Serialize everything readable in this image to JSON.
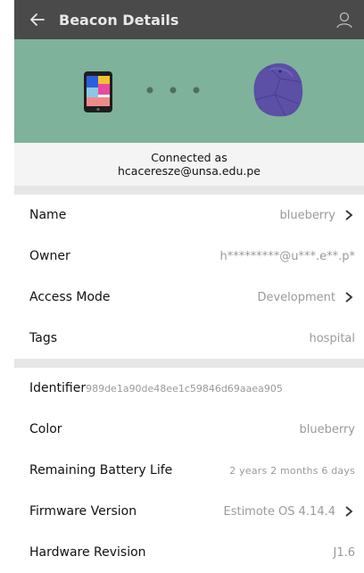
{
  "header": {
    "title": "Beacon Details",
    "back_icon": "arrow-left-icon",
    "user_icon": "user-icon",
    "bg_color": "#4a4a4a"
  },
  "hero": {
    "bg_color": "#7fb29a",
    "phone_icon": "phone-icon",
    "dots_icon": "connection-dots-icon",
    "beacon_icon": "beacon-stone-icon",
    "beacon_color": "#5b4fa6"
  },
  "connection": {
    "line1": "Connected as",
    "email": "hcaceresze@unsa.edu.pe"
  },
  "section1": [
    {
      "label": "Name",
      "value": "blueberry",
      "chevron": true
    },
    {
      "label": "Owner",
      "value": "h*********@u***.e**.p*",
      "chevron": false
    },
    {
      "label": "Access Mode",
      "value": "Development",
      "chevron": true
    },
    {
      "label": "Tags",
      "value": "hospital",
      "chevron": false
    }
  ],
  "section2": [
    {
      "label": "Identifier",
      "value": "989de1a90de48ee1c59846d69aaea905"
    },
    {
      "label": "Color",
      "value": "blueberry"
    },
    {
      "label": "Remaining Battery Life",
      "value": "2 years 2 months 6 days"
    },
    {
      "label": "Firmware Version",
      "value": "Estimote OS 4.14.4"
    },
    {
      "label": "Hardware Revision",
      "value": "J1.6"
    }
  ]
}
